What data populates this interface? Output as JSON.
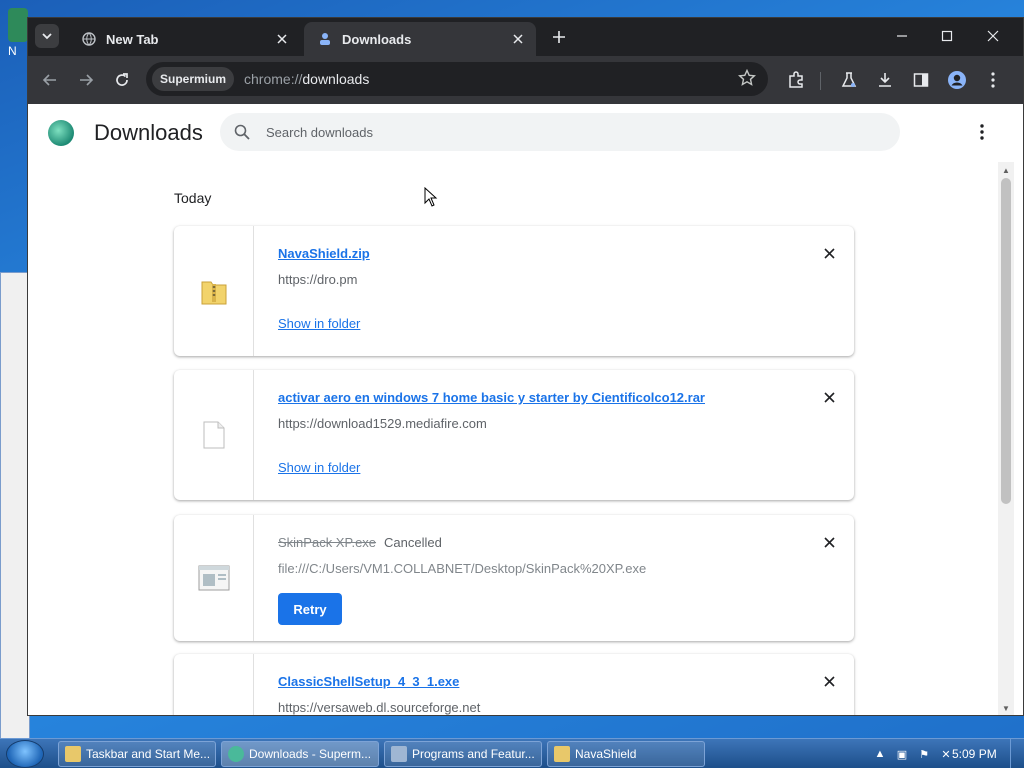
{
  "desktop": {
    "icon_label": "N"
  },
  "browser": {
    "tabs": [
      {
        "title": "New Tab",
        "favicon": "globe-icon"
      },
      {
        "title": "Downloads",
        "favicon": "download-icon",
        "active": true
      }
    ],
    "address": {
      "chip": "Supermium",
      "scheme": "chrome://",
      "path": "downloads"
    }
  },
  "downloads_page": {
    "title": "Downloads",
    "search_placeholder": "Search downloads",
    "section": "Today",
    "items": [
      {
        "filename": "NavaShield.zip",
        "source": "https://dro.pm",
        "action": "Show in folder",
        "icon": "zip-folder-icon"
      },
      {
        "filename": "activar aero en windows 7 home basic y starter by Cientificolco12.rar",
        "source": "https://download1529.mediafire.com",
        "action": "Show in folder",
        "icon": "file-icon"
      },
      {
        "filename": "SkinPack XP.exe",
        "status": "Cancelled",
        "source": "file:///C:/Users/VM1.COLLABNET/Desktop/SkinPack%20XP.exe",
        "action": "Retry",
        "icon": "exe-window-icon"
      },
      {
        "filename": "ClassicShellSetup_4_3_1.exe",
        "source": "https://versaweb.dl.sourceforge.net",
        "icon": "shell-icon"
      }
    ]
  },
  "taskbar": {
    "buttons": [
      {
        "label": "Taskbar and Start Me...",
        "icon": "folder-icon"
      },
      {
        "label": "Downloads - Superm...",
        "icon": "browser-icon",
        "active": true
      },
      {
        "label": "Programs and Featur...",
        "icon": "control-panel-icon"
      },
      {
        "label": "NavaShield",
        "icon": "folder-icon"
      }
    ],
    "clock": "5:09 PM"
  },
  "colors": {
    "accent": "#1a73e8",
    "chrome_dark": "#202124",
    "toolbar": "#35363a"
  }
}
